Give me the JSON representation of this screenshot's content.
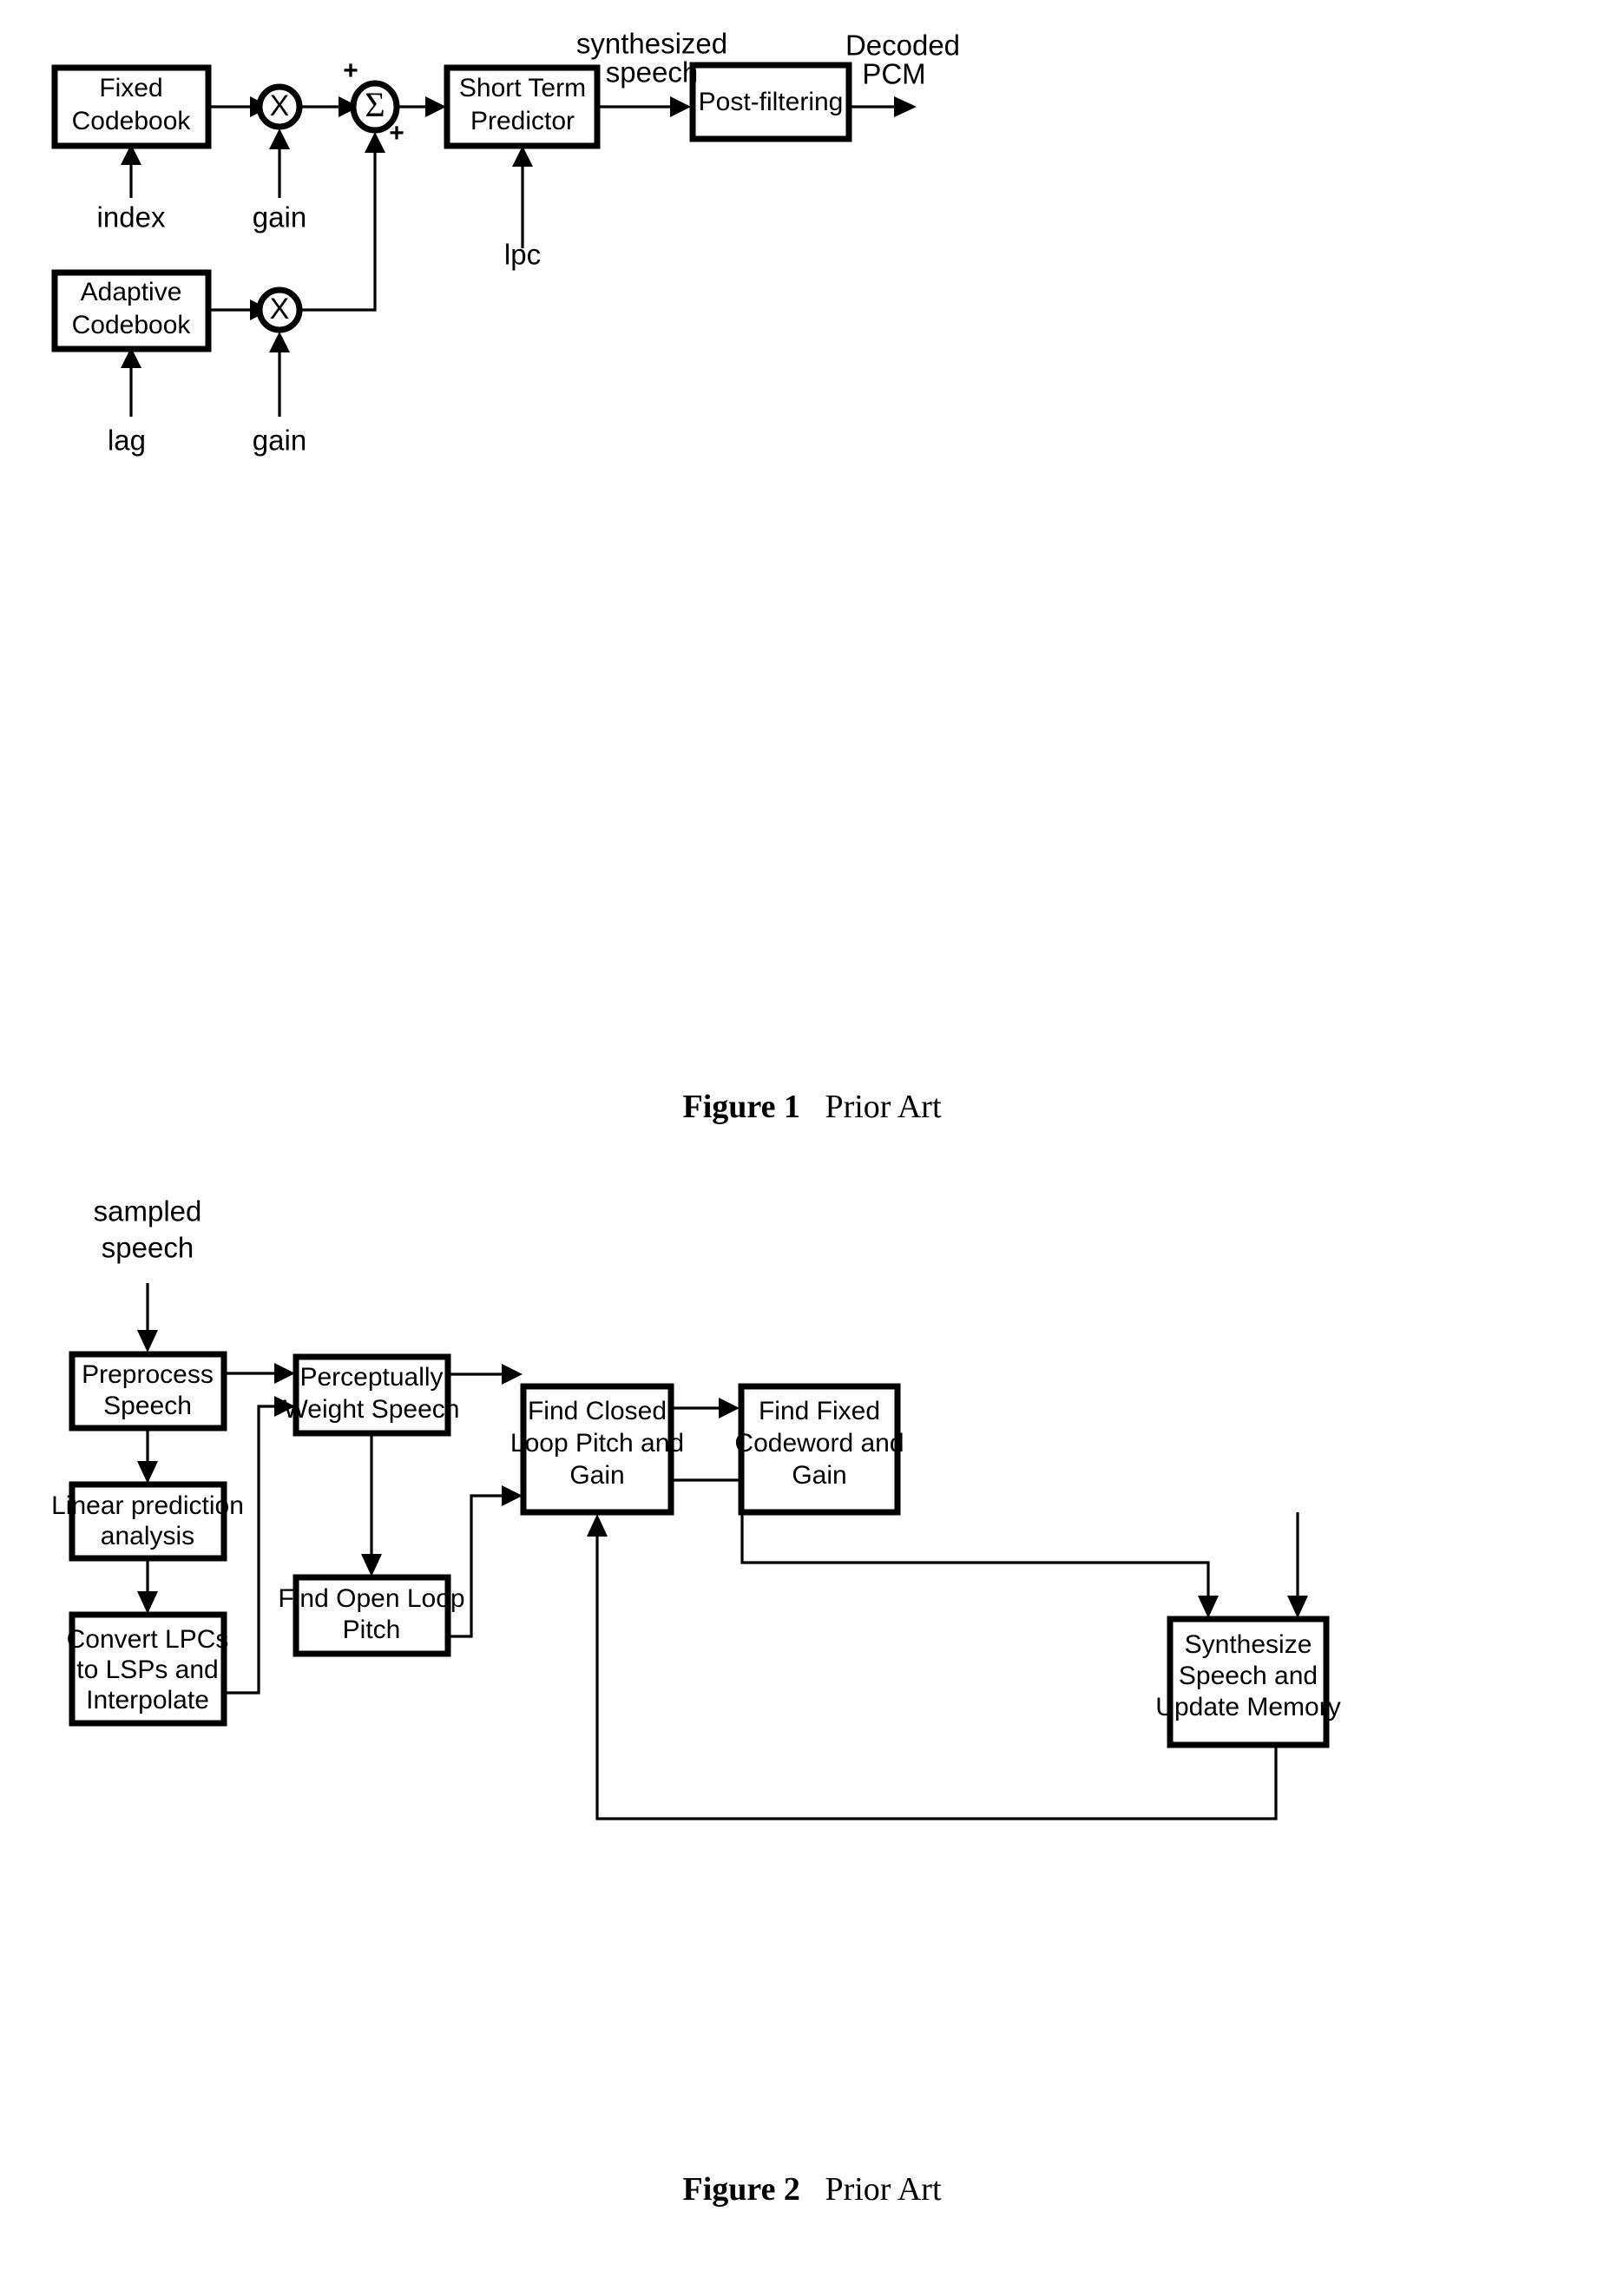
{
  "document": {
    "type": "patent-figure-sheet",
    "background_color": "#ffffff",
    "ink_color": "#000000"
  },
  "figure1": {
    "caption_number": "Figure 1",
    "caption_rest": "Prior Art",
    "description": "CELP speech decoder block diagram",
    "blocks": [
      {
        "id": "fixed-codebook",
        "line1": "Fixed",
        "line2": "Codebook"
      },
      {
        "id": "adaptive-codebook",
        "line1": "Adaptive",
        "line2": "Codebook"
      },
      {
        "id": "short-term-predictor",
        "line1": "Short Term",
        "line2": "Predictor"
      },
      {
        "id": "post-filtering",
        "line1": "Post-filtering",
        "line2": ""
      }
    ],
    "operators": [
      {
        "id": "fixed-gain-multiplier",
        "symbol": "X"
      },
      {
        "id": "adaptive-gain-multiplier",
        "symbol": "X"
      },
      {
        "id": "summation-node",
        "symbol": "Σ"
      }
    ],
    "sum_signs": [
      {
        "id": "sum-plus-top",
        "symbol": "+"
      },
      {
        "id": "sum-plus-bottom",
        "symbol": "+"
      }
    ],
    "signals": [
      {
        "id": "index-label",
        "text": "index"
      },
      {
        "id": "fixed-gain-label",
        "text": "gain"
      },
      {
        "id": "lag-label",
        "text": "lag"
      },
      {
        "id": "adaptive-gain-label",
        "text": "gain"
      },
      {
        "id": "lpc-label",
        "text": "lpc"
      },
      {
        "id": "synthesized-speech-line1",
        "text": "synthesized"
      },
      {
        "id": "synthesized-speech-line2",
        "text": "speech"
      },
      {
        "id": "decoded-pcm-line1",
        "text": "Decoded"
      },
      {
        "id": "decoded-pcm-line2",
        "text": "PCM"
      }
    ]
  },
  "figure2": {
    "caption_number": "Figure 2",
    "caption_rest": "Prior Art",
    "description": "CELP speech encoder flow diagram",
    "input_label_line1": "sampled",
    "input_label_line2": "speech",
    "blocks": [
      {
        "id": "preprocess-speech",
        "line1": "Preprocess",
        "line2": "Speech",
        "line3": ""
      },
      {
        "id": "linear-prediction-analysis",
        "line1": "Linear prediction",
        "line2": "analysis",
        "line3": ""
      },
      {
        "id": "convert-lpcs",
        "line1": "Convert LPCs",
        "line2": "to LSPs and",
        "line3": "Interpolate"
      },
      {
        "id": "perceptually-weight-speech",
        "line1": "Perceptually",
        "line2": "Weight Speech",
        "line3": ""
      },
      {
        "id": "find-open-loop-pitch",
        "line1": "Find Open Loop",
        "line2": "Pitch",
        "line3": ""
      },
      {
        "id": "find-closed-loop-pitch-and-gain",
        "line1": "Find Closed",
        "line2": "Loop Pitch and",
        "line3": "Gain"
      },
      {
        "id": "find-fixed-codeword-and-gain",
        "line1": "Find Fixed",
        "line2": "Codeword and",
        "line3": "Gain"
      },
      {
        "id": "synthesize-speech-and-update-memory",
        "line1": "Synthesize",
        "line2": "Speech and",
        "line3": "Update Memory"
      }
    ]
  }
}
